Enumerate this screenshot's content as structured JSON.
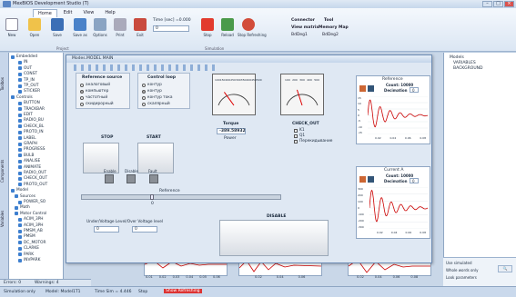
{
  "app": {
    "title": "MexBIOS Development Studio (T) "
  },
  "menu_tabs": [
    "Home",
    "Edit",
    "View",
    "Help"
  ],
  "ribbon": {
    "buttons": [
      "New",
      "Open",
      "Save",
      "Save as",
      "Options",
      "Print",
      "Exit"
    ],
    "time_label": "Time [sec] =0.000",
    "time_value": "0",
    "stop": "Stop",
    "reload": "Reload",
    "stop_refreshing": "Stop Refreshing",
    "group_project": "Project",
    "group_simulation": "Simulation",
    "connector": "Connector",
    "tool": "Tool",
    "view_matrix": "View matrix",
    "memory_map": "Memory Map",
    "bdeg1": "BdDeg1",
    "bdeg2": "BdDeg2"
  },
  "left_tabs": [
    "Toolbox",
    "Components",
    "Variables"
  ],
  "tree": [
    "Embedded",
    "IN",
    "OUT",
    "CONST",
    "TP_IN",
    "TP_OUT",
    "STICKER",
    "Controls",
    "BUTTON",
    "TRACKBAR",
    "EDIT",
    "RADIO_BU",
    "CHECK_BL",
    "PROTO_IN",
    "LABEL",
    "GRAPH",
    "PROGRESS",
    "BULB",
    "ANALISE",
    "ANIMATE",
    "RADIO_OUT",
    "CHECK_OUT",
    "PROTO_OUT",
    "Model",
    "Sources",
    "POWER_SO",
    "Math",
    "Motor Control",
    "ACIM_3PH",
    "ACIM_3PH",
    "PMSM_AB",
    "PMSM",
    "DC_MOTOR",
    "CLARKE",
    "PARK",
    "INVPARK"
  ],
  "right_tree": [
    "Models",
    "VARIABLES",
    "BACKGROUND"
  ],
  "props": {
    "use_simulated": "Use simulated",
    "whole_words": "Whole words only",
    "look_param": "Look parameters"
  },
  "window": {
    "title": "Modes.MODEL MAIN"
  },
  "ref_source": {
    "title": "Reference source",
    "options": [
      "аналоговый",
      "компьютер",
      "частотный",
      "скидирорный"
    ],
    "selected": 1
  },
  "ctrl_loop": {
    "title": "Control loop",
    "options": [
      "контур",
      "контур",
      "контур тока",
      "скалярный"
    ],
    "selected": 1
  },
  "torque": {
    "label": "Torque",
    "value": "-389.58932",
    "power": "Power"
  },
  "check_out": {
    "title": "CHECK_OUT",
    "items": [
      "K1",
      "Q1",
      "Перекидывание"
    ]
  },
  "stop_label": "STOP",
  "start_label": "START",
  "indicators": [
    "Enable",
    "Disable",
    "Fault"
  ],
  "reference_label": "Reference",
  "reference_value": "0",
  "voltage_label": "Under/Voltage Level/Over Voltage level",
  "voltage_values": [
    "0",
    "0"
  ],
  "disable_label": "DISABLE",
  "gauge1": {
    "ticks": [
      "100",
      "150",
      "200",
      "250",
      "300",
      "350",
      "400",
      "450",
      "500"
    ],
    "needle": 0.3
  },
  "gauge2": {
    "ticks": [
      "100",
      "200",
      "300",
      "400",
      "500"
    ],
    "needle": 0.4
  },
  "ref_chart": {
    "title": "Reference",
    "count_label": "Count: 10000",
    "decimation_label": "Decimation",
    "decimation": "0",
    "ylim": [
      -15,
      15
    ],
    "yticks": [
      "15",
      "10",
      "5",
      "0",
      "-5",
      "-10",
      "-15"
    ],
    "xticks": [
      "0.02",
      "0.04",
      "0.06",
      "0.08"
    ],
    "color": "#cc0000"
  },
  "current_chart": {
    "title": "Current A",
    "count_label": "Count: 10000",
    "decimation_label": "Decimation",
    "decimation": "0",
    "ylim": [
      -300,
      300
    ],
    "yticks": [
      "300",
      "200",
      "100",
      "0",
      "-100",
      "-200",
      "-300"
    ],
    "xticks": [
      "0.02",
      "0.04",
      "0.06",
      "0.08"
    ],
    "color": "#cc0000"
  },
  "bottom_chart_xticks": [
    "0.01",
    "0.02",
    "0.03",
    "0.04",
    "0.05",
    "0.06"
  ],
  "bottom2_xticks": [
    "0.02",
    "0.04",
    "0.06"
  ],
  "bottom3_xticks": [
    "0.02",
    "0.04",
    "0.06",
    "0.08"
  ],
  "errors": "Errors: 0",
  "warnings": "Warnings: 4",
  "status": {
    "mode": "Simulation only",
    "model": "Model: Model1T1",
    "time": "Time Sim = 4.446",
    "stop": "Stop",
    "show": "Show Refreshing"
  }
}
